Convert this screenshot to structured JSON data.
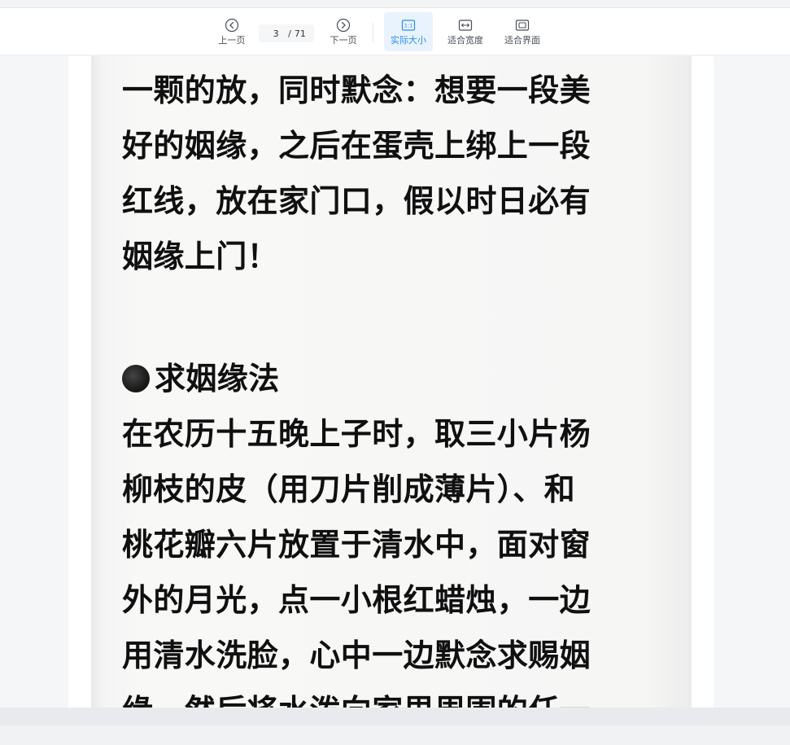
{
  "toolbar": {
    "prev_label": "上一页",
    "next_label": "下一页",
    "current_page": "3",
    "separator": "/",
    "total_pages": "71",
    "actual_size_label": "实际大小",
    "fit_width_label": "适合宽度",
    "fit_window_label": "适合界面",
    "actual_size_icon_text": "1:1",
    "accent_color": "#2d8cf0"
  },
  "icons": {
    "prev": "chevron-left-circle-icon",
    "next": "chevron-right-circle-icon",
    "actual_size": "actual-size-icon",
    "fit_width": "fit-width-icon",
    "fit_window": "fit-window-icon"
  },
  "document": {
    "lines_top": [
      "一颗的放，同时默念：想要一段美",
      "好的姻缘，之后在蛋壳上绑上一段",
      "红线，放在家门口，假以时日必有",
      "姻缘上门！"
    ],
    "heading": "求姻缘法",
    "lines_bottom": [
      "在农历十五晚上子时，取三小片杨",
      "柳枝的皮（用刀片削成薄片）、和",
      "桃花瓣六片放置于清水中，面对窗",
      "外的月光，点一小根红蜡烛，一边",
      "用清水洗脸，心中一边默念求赐姻",
      "缘，然后将水泼向家里周围的任一"
    ]
  }
}
